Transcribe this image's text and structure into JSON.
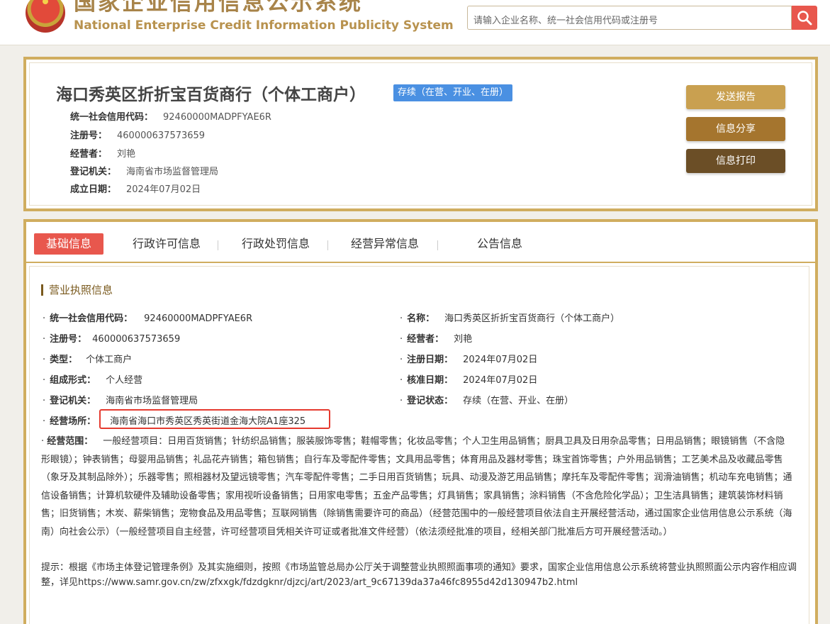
{
  "header": {
    "title_cn": "国家企业信用信息公示系统",
    "title_en": "National Enterprise Credit Information Publicity System",
    "search_placeholder": "请输入企业名称、统一社会信用代码或注册号"
  },
  "company": {
    "name": "海口秀英区折折宝百货商行（个体工商户）",
    "status": "存续（在营、开业、在册）",
    "rows": [
      {
        "label": "统一社会信用代码：",
        "value": "92460000MADPFYAE6R"
      },
      {
        "label": "注册号：",
        "value": "460000637573659"
      },
      {
        "label": "经营者：",
        "value": "刘艳"
      },
      {
        "label": "登记机关：",
        "value": "海南省市场监督管理局"
      },
      {
        "label": "成立日期：",
        "value": "2024年07月02日"
      }
    ]
  },
  "actions": {
    "report": "发送报告",
    "share": "信息分享",
    "print": "信息打印"
  },
  "tabs": [
    "基础信息",
    "行政许可信息",
    "行政处罚信息",
    "经营异常信息",
    "公告信息"
  ],
  "license": {
    "section_title": "营业执照信息",
    "left": [
      {
        "label": "统一社会信用代码：",
        "value": "92460000MADPFYAE6R"
      },
      {
        "label": "注册号：",
        "value": "460000637573659"
      },
      {
        "label": "类型：",
        "value": "个体工商户"
      },
      {
        "label": "组成形式：",
        "value": "个人经营"
      },
      {
        "label": "登记机关：",
        "value": "海南省市场监督管理局"
      }
    ],
    "right": [
      {
        "label": "名称：",
        "value": "海口秀英区折折宝百货商行（个体工商户）"
      },
      {
        "label": "经营者：",
        "value": "刘艳"
      },
      {
        "label": "注册日期：",
        "value": "2024年07月02日"
      },
      {
        "label": "核准日期：",
        "value": "2024年07月02日"
      },
      {
        "label": "登记状态：",
        "value": "存续（在营、开业、在册）"
      }
    ],
    "address_label": "经营场所：",
    "address_value": "海南省海口市秀英区秀英街道金海大院A1座325",
    "scope_label": "经营范围：",
    "scope_value": "一般经营项目：日用百货销售；针纺织品销售；服装服饰零售；鞋帽零售；化妆品零售；个人卫生用品销售；厨具卫具及日用杂品零售；日用品销售；眼镜销售（不含隐形眼镜）；钟表销售；母婴用品销售；礼品花卉销售；箱包销售；自行车及零配件零售；文具用品零售；体育用品及器材零售；珠宝首饰零售；户外用品销售；工艺美术品及收藏品零售（象牙及其制品除外）；乐器零售；照相器材及望远镜零售；汽车零配件零售；二手日用百货销售；玩具、动漫及游艺用品销售；摩托车及零配件零售；润滑油销售；机动车充电销售；通信设备销售；计算机软硬件及辅助设备零售；家用视听设备销售；日用家电零售；五金产品零售；灯具销售；家具销售；涂料销售（不含危险化学品）；卫生洁具销售；建筑装饰材料销售；旧货销售；木炭、薪柴销售；宠物食品及用品零售；互联网销售（除销售需要许可的商品）（经营范围中的一般经营项目依法自主开展经营活动，通过国家企业信用信息公示系统（海南）向社会公示）（一般经营项目自主经营，许可经营项目凭相关许可证或者批准文件经营）（依法须经批准的项目，经相关部门批准后方可开展经营活动。）",
    "tip": "提示：根据《市场主体登记管理条例》及其实施细则，按照《市场监管总局办公厅关于调整营业执照照面事项的通知》要求，国家企业信用信息公示系统将营业执照照面公示内容作相应调整，详见https://www.samr.gov.cn/zw/zfxxgk/fdzdgknr/djzcj/art/2023/art_9c67139da37a46fc8955d42d130947b2.html"
  },
  "colors": {
    "gold_border": "#d0ad5f",
    "tab_active": "#e8574d",
    "badge_blue": "#4a90e2",
    "btn_report": "#c9a050",
    "btn_share": "#a5752e",
    "btn_print": "#6b4e26"
  }
}
